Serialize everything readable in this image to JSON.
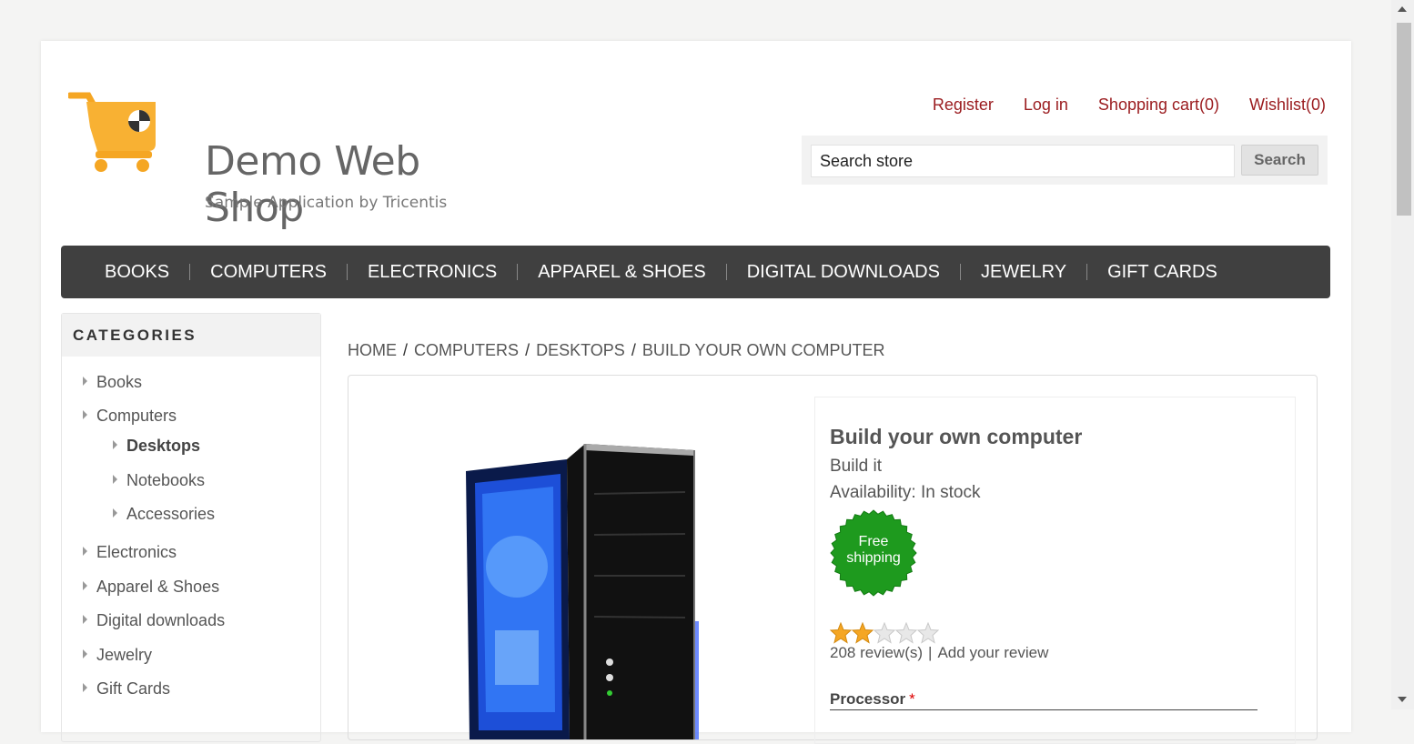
{
  "logo": {
    "title": "Demo Web Shop",
    "subtitle": "Sample Application by Tricentis",
    "icon": "shopping-cart-logo"
  },
  "header_links": [
    "Register",
    "Log in",
    "Shopping cart(0)",
    "Wishlist(0)"
  ],
  "search": {
    "value": "Search store",
    "button": "Search"
  },
  "topnav": [
    "BOOKS",
    "COMPUTERS",
    "ELECTRONICS",
    "APPAREL & SHOES",
    "DIGITAL DOWNLOADS",
    "JEWELRY",
    "GIFT CARDS"
  ],
  "sidebar": {
    "title": "CATEGORIES",
    "items": [
      "Books",
      "Computers",
      "Desktops",
      "Notebooks",
      "Accessories",
      "Electronics",
      "Apparel & Shoes",
      "Digital downloads",
      "Jewelry",
      "Gift Cards"
    ],
    "active": "Desktops"
  },
  "breadcrumb": [
    "HOME",
    "COMPUTERS",
    "DESKTOPS",
    "BUILD YOUR OWN COMPUTER"
  ],
  "product": {
    "name": "Build your own computer",
    "short_description": "Build it",
    "availability": "Availability: In stock",
    "badge": "Free shipping",
    "rating": 2,
    "rating_max": 5,
    "reviews": "208 review(s)",
    "add_review": "Add your review",
    "attribute_label": "Processor",
    "required_mark": "*"
  },
  "colors": {
    "link": "#9b1d20",
    "nav_bg": "#404040",
    "badge": "#1e9a1e",
    "star": "#f5a623"
  }
}
